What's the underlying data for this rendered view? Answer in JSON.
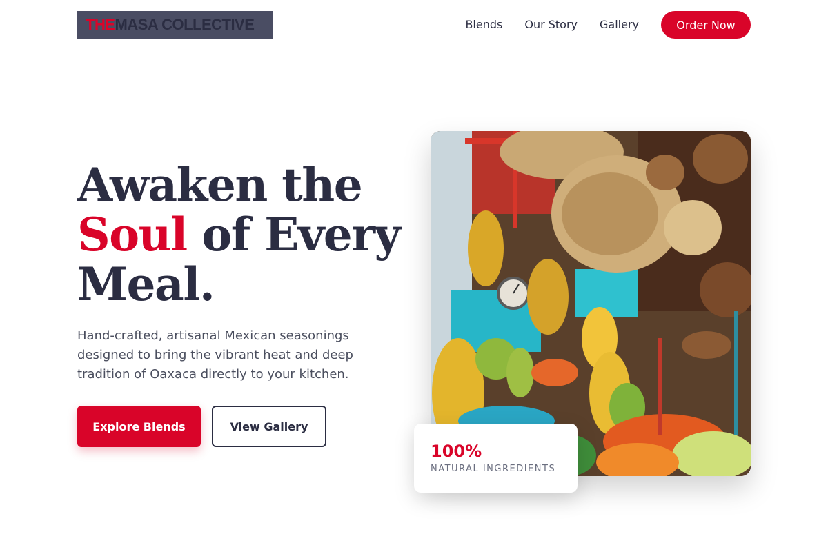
{
  "brand": {
    "logo_prefix": "THE",
    "logo_rest": " MASA COLLECTIVE",
    "accent_color": "#d90429",
    "text_color": "#2b2d42"
  },
  "nav": {
    "links": [
      "Blends",
      "Our Story",
      "Gallery"
    ],
    "cta_label": "Order Now"
  },
  "hero": {
    "title_line1": "Awaken the",
    "title_accent": "Soul",
    "title_line2_rest": " of Every",
    "title_line3": "Meal.",
    "description": "Hand-crafted, artisanal Mexican seasonings designed to bring the vibrant heat and deep tradition of Oaxaca directly to your kitchen.",
    "primary_button": "Explore Blends",
    "secondary_button": "View Gallery",
    "image_alt": "Market stall with hanging woven baskets and bananas"
  },
  "stat": {
    "value": "100%",
    "label": "NATURAL INGREDIENTS"
  }
}
